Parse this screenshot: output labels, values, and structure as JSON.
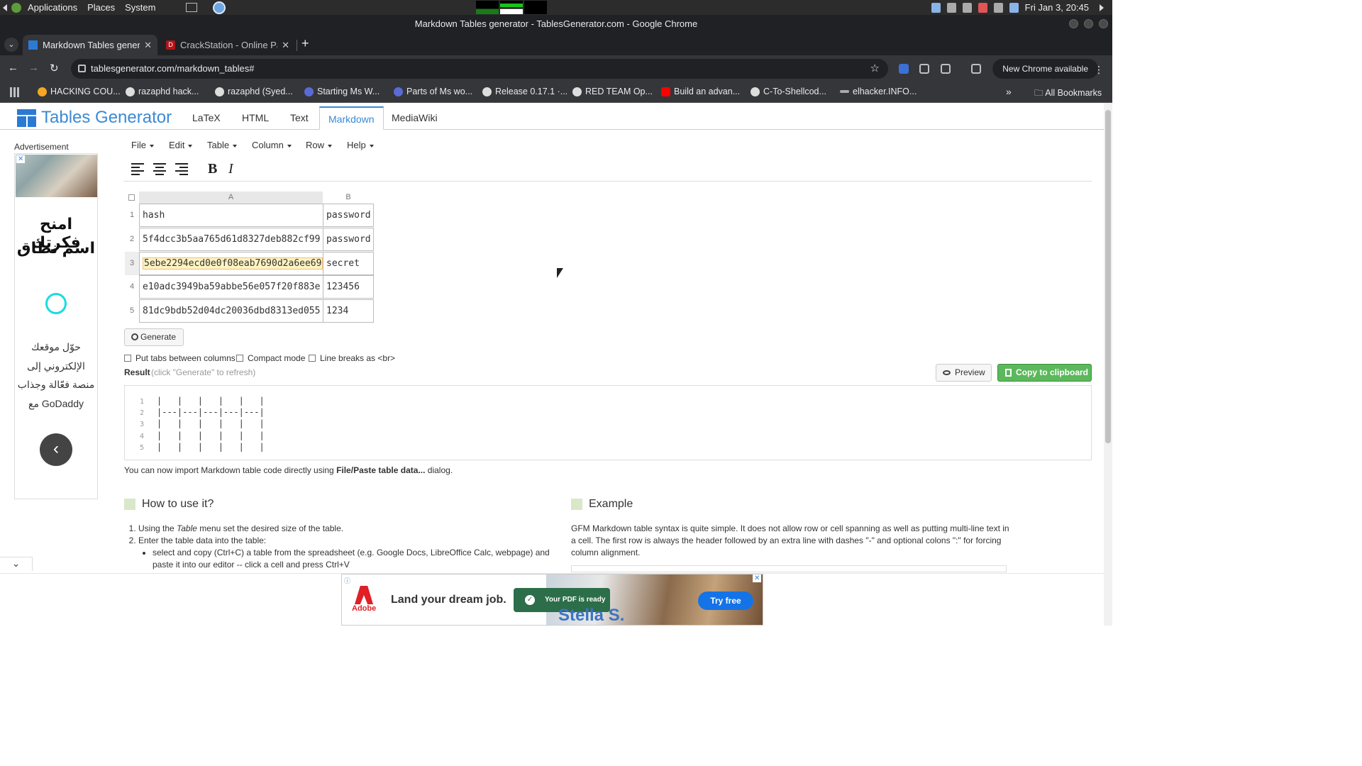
{
  "os": {
    "menus": [
      "Applications",
      "Places",
      "System"
    ],
    "clock": "Fri Jan 3, 20:45"
  },
  "window": {
    "title": "Markdown Tables generator - TablesGenerator.com - Google Chrome"
  },
  "tabs": [
    {
      "label": "Markdown Tables generator",
      "active": true
    },
    {
      "label": "CrackStation - Online Pas",
      "active": false
    }
  ],
  "toolbar": {
    "url": "tablesgenerator.com/markdown_tables#",
    "new_chrome": "New Chrome available"
  },
  "bookmarks": [
    {
      "label": "HACKING COU...",
      "color": "#f5a623"
    },
    {
      "label": "razaphd hack...",
      "color": "#dddddd"
    },
    {
      "label": "razaphd (Syed...",
      "color": "#dddddd"
    },
    {
      "label": "Starting Ms W...",
      "color": "#5a6bd8"
    },
    {
      "label": "Parts of Ms wo...",
      "color": "#5a6bd8"
    },
    {
      "label": "Release 0.17.1 ·...",
      "color": "#dddddd"
    },
    {
      "label": "RED TEAM Op...",
      "color": "#dddddd"
    },
    {
      "label": "Build an advan...",
      "color": "#ff0000"
    },
    {
      "label": "C-To-Shellcod...",
      "color": "#dddddd"
    },
    {
      "label": "elhacker.INFO...",
      "color": "#aaaaaa"
    }
  ],
  "bookmarks_all": "All Bookmarks",
  "site": {
    "logo": "Tables Generator",
    "nav": [
      "LaTeX",
      "HTML",
      "Text",
      "Markdown",
      "MediaWiki"
    ],
    "active_nav": "Markdown"
  },
  "ad_side": {
    "label": "Advertisement",
    "headline": [
      "امنح فكرتك",
      "اسم نطاق"
    ],
    "body": [
      "حوّل موقعك",
      "الإلكتروني إلى",
      "منصة فعّالة وجذاب",
      "GoDaddy مع"
    ]
  },
  "editor": {
    "menus": [
      "File",
      "Edit",
      "Table",
      "Column",
      "Row",
      "Help"
    ],
    "bold": "B",
    "italic": "I",
    "columns": [
      "A",
      "B"
    ],
    "rows": [
      {
        "n": "1",
        "a": "hash",
        "b": "password"
      },
      {
        "n": "2",
        "a": "5f4dcc3b5aa765d61d8327deb882cf99",
        "b": "password"
      },
      {
        "n": "3",
        "a": "5ebe2294ecd0e0f08eab7690d2a6ee69",
        "b": "secret"
      },
      {
        "n": "4",
        "a": "e10adc3949ba59abbe56e057f20f883e",
        "b": "123456"
      },
      {
        "n": "5",
        "a": "81dc9bdb52d04dc20036dbd8313ed055",
        "b": "1234"
      }
    ],
    "generate": "Generate",
    "options": [
      "Put tabs between columns",
      "Compact mode",
      "Line breaks as <br>"
    ],
    "result_label": "Result",
    "result_hint": "(click \"Generate\" to refresh)",
    "preview": "Preview",
    "copy": "Copy to clipboard",
    "result_lines": [
      {
        "n": "1",
        "code": "|   |   |   |   |   |"
      },
      {
        "n": "2",
        "code": "|---|---|---|---|---|"
      },
      {
        "n": "3",
        "code": "|   |   |   |   |   |"
      },
      {
        "n": "4",
        "code": "|   |   |   |   |   |"
      },
      {
        "n": "5",
        "code": "|   |   |   |   |   |"
      }
    ],
    "import_note_pre": "You can now import Markdown table code directly using ",
    "import_note_bold": "File/Paste table data...",
    "import_note_post": " dialog."
  },
  "howto": {
    "title": "How to use it?",
    "step1_pre": "Using the ",
    "step1_em": "Table",
    "step1_post": " menu set the desired size of the table.",
    "step2": "Enter the table data into the table:",
    "sub1": "select and copy (Ctrl+C) a table from the spreadsheet (e.g. Google Docs, LibreOffice Calc, webpage) and paste it into our editor -- click a cell and press Ctrl+V"
  },
  "example": {
    "title": "Example",
    "text": "GFM Markdown table syntax is quite simple. It does not allow row or cell spanning as well as putting multi-line text in a cell. The first row is always the header followed by an extra line with dashes \"-\" and optional colons \":\" for forcing column alignment."
  },
  "bottom_ad": {
    "brand": "Adobe",
    "title": "Land your dream job.",
    "toast": "Your PDF is ready",
    "name": "Stella S.",
    "cta": "Try free"
  }
}
